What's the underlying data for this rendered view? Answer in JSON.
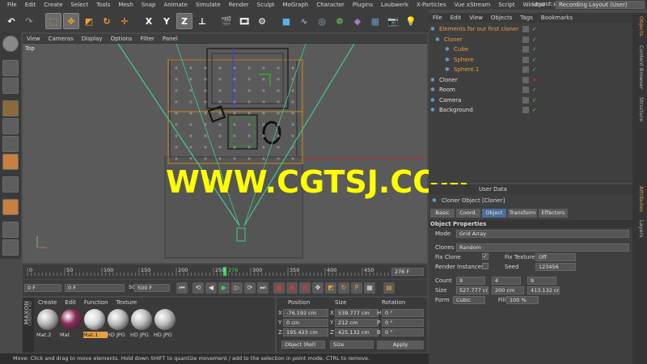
{
  "menubar": {
    "items": [
      "File",
      "Edit",
      "Create",
      "Select",
      "Tools",
      "Mesh",
      "Snap",
      "Animate",
      "Simulate",
      "Render",
      "Sculpt",
      "MoGraph",
      "Character",
      "Plugins",
      "Laubwerk",
      "X-Particles",
      "Vue xStream",
      "Script",
      "Window",
      "Help"
    ],
    "layout_label": "Layout:",
    "layout_value": "Recording Layout (User)"
  },
  "toolbar": {
    "axis_x": "X",
    "axis_y": "Y",
    "axis_z": "Z"
  },
  "viewport": {
    "menu": [
      "View",
      "Cameras",
      "Display",
      "Options",
      "Filter",
      "Panel"
    ],
    "label": "Top"
  },
  "watermark": "WWW.CGTSJ.COM",
  "timeline": {
    "ticks": [
      "0",
      "50",
      "100",
      "150",
      "200",
      "250",
      "300",
      "350",
      "400",
      "450"
    ],
    "current": "276",
    "end_value": "276 F"
  },
  "transport": {
    "start": "0 F",
    "field2": "0 F",
    "field3": "500 F",
    "end": "500 F"
  },
  "materials": {
    "menu": [
      "Create",
      "Edit",
      "Function",
      "Texture"
    ],
    "items": [
      {
        "label": "Mat.2",
        "color": "#b8b8b8"
      },
      {
        "label": "Mat",
        "color": "#8a2a5a"
      },
      {
        "label": "Mat.1",
        "color": "#d8d8d8"
      },
      {
        "label": "HD JPG",
        "color": "#c0c0c0"
      },
      {
        "label": "HD JPG",
        "color": "#c0c0c0"
      },
      {
        "label": "HD JPG",
        "color": "#c0c0c0"
      }
    ],
    "brand_top": "MAXON",
    "brand_bottom": "CINEMA 4D"
  },
  "coords": {
    "headers": [
      "Position",
      "Size",
      "Rotation"
    ],
    "rows": [
      {
        "axis": "X",
        "pos": "-76.192 cm",
        "saxis": "X",
        "size": "539.777 cm",
        "raxis": "H",
        "rot": "0 °"
      },
      {
        "axis": "Y",
        "pos": "0 cm",
        "saxis": "Y",
        "size": "212 cm",
        "raxis": "P",
        "rot": "0 °"
      },
      {
        "axis": "Z",
        "pos": "195.423 cm",
        "saxis": "Z",
        "size": "425.132 cm",
        "raxis": "B",
        "rot": "0 °"
      }
    ],
    "mode": "Object (Rel)",
    "size_mode": "Size",
    "apply": "Apply"
  },
  "status": "Move: Click and drag to move elements. Hold down SHIFT to quantize movement / add to the selection in point mode, CTRL to remove.",
  "objects": {
    "menu": [
      "File",
      "Edit",
      "View",
      "Objects",
      "Tags",
      "Bookmarks"
    ],
    "tree": [
      {
        "label": "Elements for our first cloner",
        "indent": 2,
        "color": "#e8a040"
      },
      {
        "label": "Cloner",
        "indent": 8,
        "color": "#e8a040"
      },
      {
        "label": "Cube",
        "indent": 20,
        "color": "#e8a040"
      },
      {
        "label": "Sphere",
        "indent": 20,
        "color": "#e8a040"
      },
      {
        "label": "Sphere.1",
        "indent": 20,
        "color": "#e8a040"
      },
      {
        "label": "Cloner",
        "indent": 2,
        "color": "#e0e0e0"
      },
      {
        "label": "Room",
        "indent": 2,
        "color": "#e0e0e0"
      },
      {
        "label": "Camera",
        "indent": 2,
        "color": "#e0e0e0"
      },
      {
        "label": "Background",
        "indent": 2,
        "color": "#e0e0e0"
      }
    ]
  },
  "attributes": {
    "header": "User Data",
    "title": "Cloner Object [Cloner]",
    "tabs": [
      "Basic",
      "Coord.",
      "Object",
      "Transform",
      "Effectors"
    ],
    "active_tab": "Object",
    "section": "Object Properties",
    "mode_label": "Mode",
    "mode_value": "Grid Array",
    "clones_label": "Clones",
    "clones_value": "Random",
    "fix_clone": "Fix Clone",
    "fix_texture_label": "Fix Texture",
    "fix_texture_value": "Off",
    "render_instances": "Render Instances",
    "seed_label": "Seed",
    "seed_value": "123456",
    "count_label": "Count",
    "count": [
      "9",
      "4",
      "9"
    ],
    "size_label": "Size",
    "size": [
      "527.777 cm",
      "200 cm",
      "413.132 cm"
    ],
    "form_label": "Form",
    "form_value": "Cubic",
    "fill_label": "Fill",
    "fill_value": "100 %"
  },
  "side_tabs": [
    "Objects",
    "Content Browser",
    "Structure",
    "Attributes",
    "Layers"
  ]
}
